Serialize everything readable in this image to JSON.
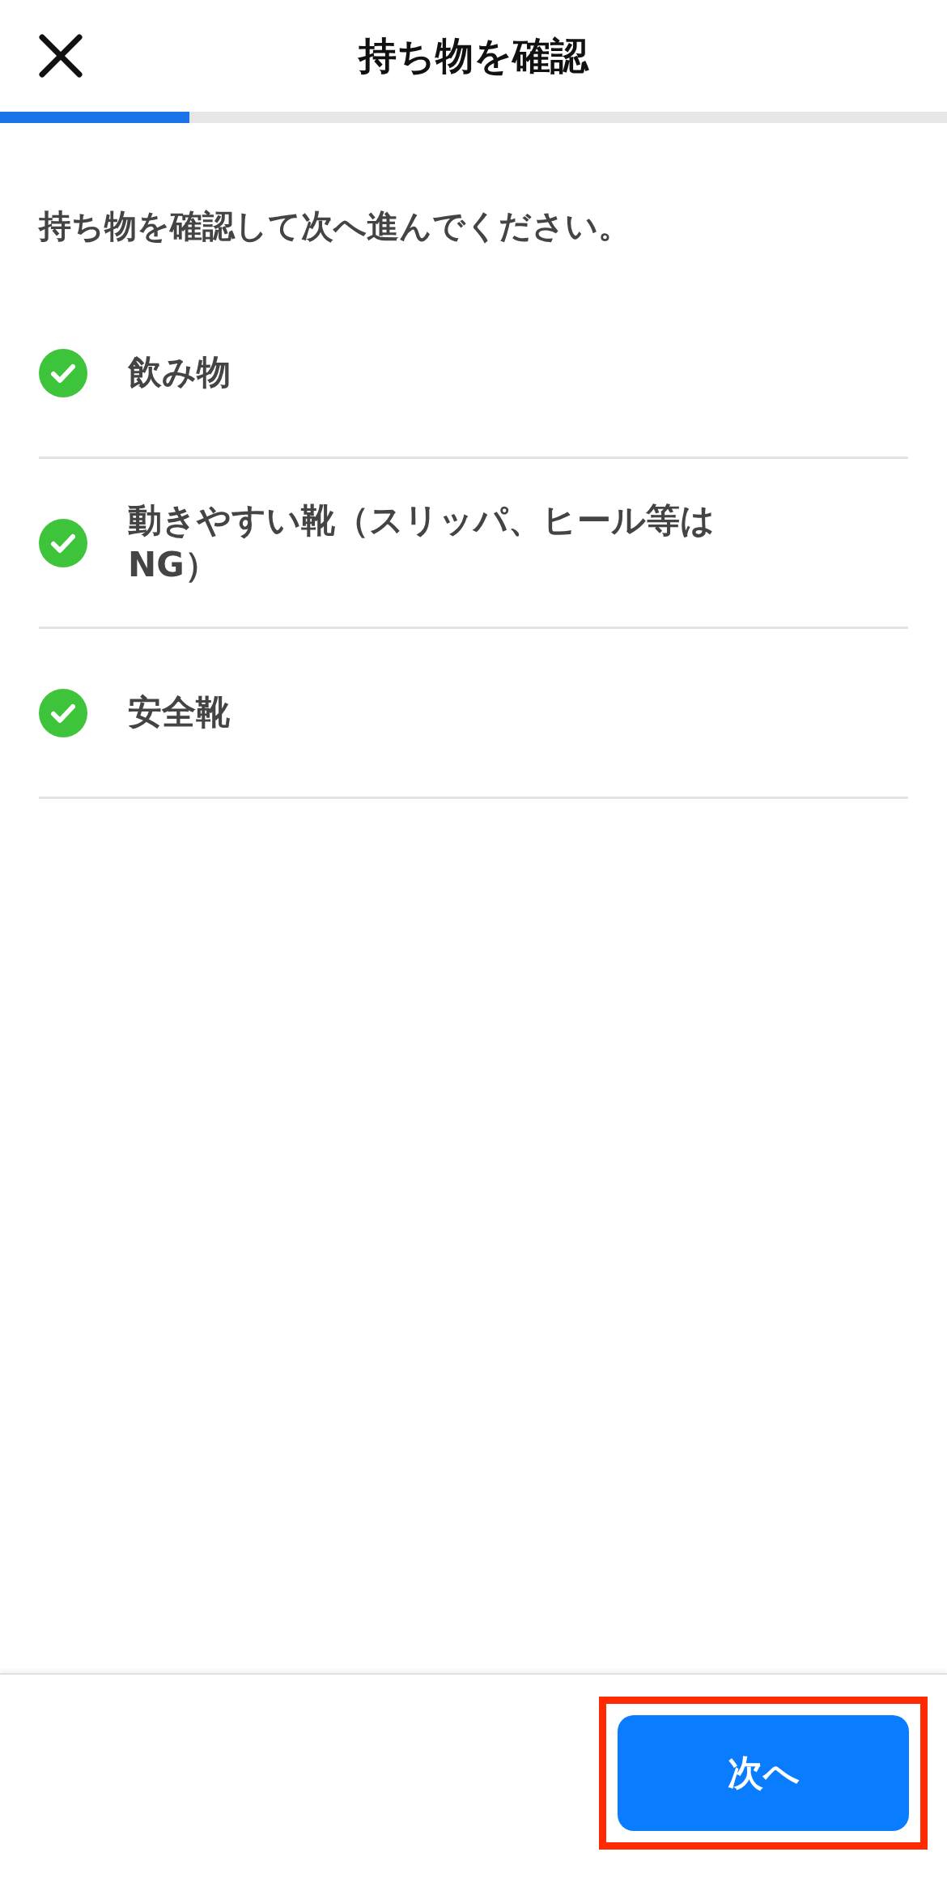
{
  "header": {
    "title": "持ち物を確認"
  },
  "progress": {
    "level": 0.2
  },
  "instruction": "持ち物を確認して次へ進んでください。",
  "items": [
    {
      "label": "飲み物",
      "checked": true
    },
    {
      "label": "動きやすい靴（スリッパ、ヒール等はNG）",
      "checked": true
    },
    {
      "label": "安全靴",
      "checked": true
    }
  ],
  "footer": {
    "button": "次へ",
    "highlighted": true
  }
}
